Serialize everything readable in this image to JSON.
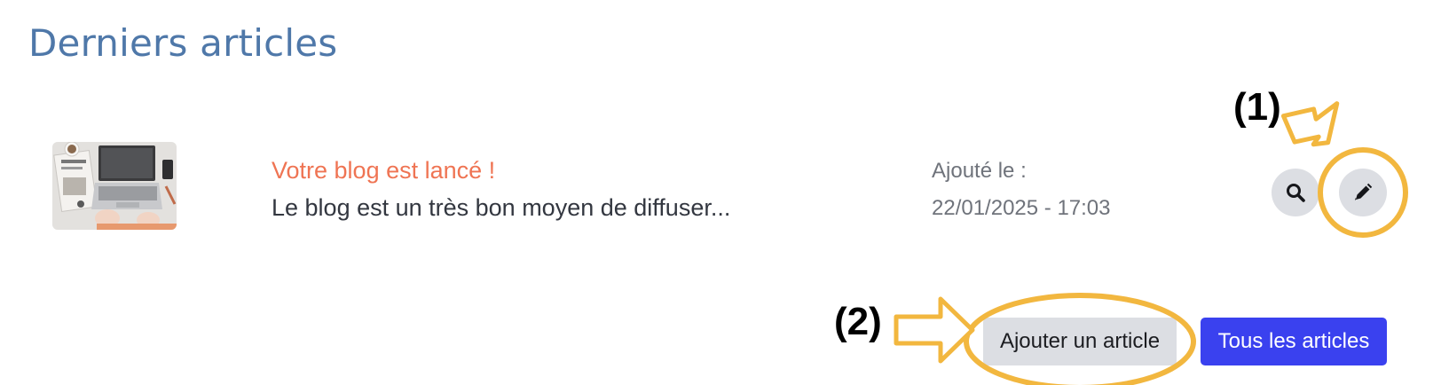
{
  "section": {
    "title": "Derniers articles"
  },
  "article": {
    "thumbnail_icon": "laptop-desk-photo",
    "title": "Votre blog est lancé !",
    "excerpt": "Le blog est un très bon moyen de diffuser...",
    "date_label": "Ajouté le :",
    "date_value": "22/01/2025 - 17:03",
    "view_icon": "search-icon",
    "edit_icon": "pencil-icon"
  },
  "actions": {
    "add_label": "Ajouter un article",
    "all_label": "Tous les articles"
  },
  "annotations": {
    "callout_1": "(1)",
    "callout_2": "(2)",
    "highlight_color": "#f2b73f"
  },
  "colors": {
    "title": "#4f78a9",
    "article_title": "#ef7453",
    "primary_button": "#3a41ef",
    "secondary_button": "#dcdee3"
  }
}
